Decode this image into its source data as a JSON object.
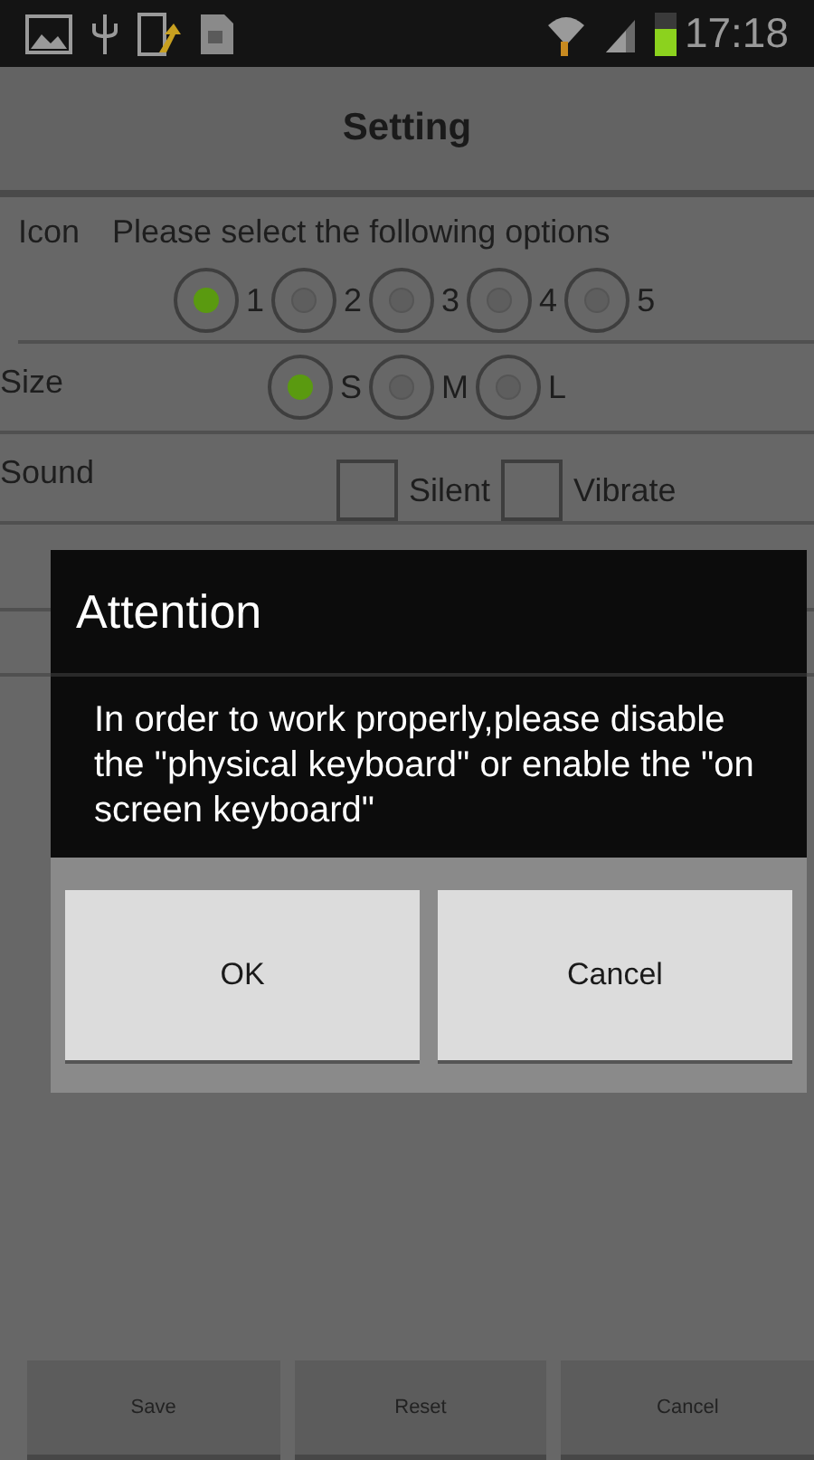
{
  "status_bar": {
    "time": "17:18"
  },
  "title": "Setting",
  "settings": [
    {
      "kind": "radio",
      "label": "Icon",
      "hint": "Please select the following options",
      "options": [
        {
          "label": "1",
          "selected": true
        },
        {
          "label": "2",
          "selected": false
        },
        {
          "label": "3",
          "selected": false
        },
        {
          "label": "4",
          "selected": false
        },
        {
          "label": "5",
          "selected": false
        }
      ]
    },
    {
      "kind": "radio",
      "label": "Size",
      "options": [
        {
          "label": "S",
          "selected": true
        },
        {
          "label": "M",
          "selected": false
        },
        {
          "label": "L",
          "selected": false
        }
      ]
    },
    {
      "kind": "check",
      "label": "Sound",
      "options": [
        {
          "label": "Silent",
          "checked": false
        },
        {
          "label": "Vibrate",
          "checked": false
        }
      ]
    }
  ],
  "dialog": {
    "title": "Attention",
    "message": "In order to work properly,please disable the \"physical keyboard\" or enable the \"on screen keyboard\"",
    "buttons": [
      "OK",
      "Cancel"
    ]
  },
  "bottom_buttons": [
    "Save",
    "Reset",
    "Cancel"
  ]
}
